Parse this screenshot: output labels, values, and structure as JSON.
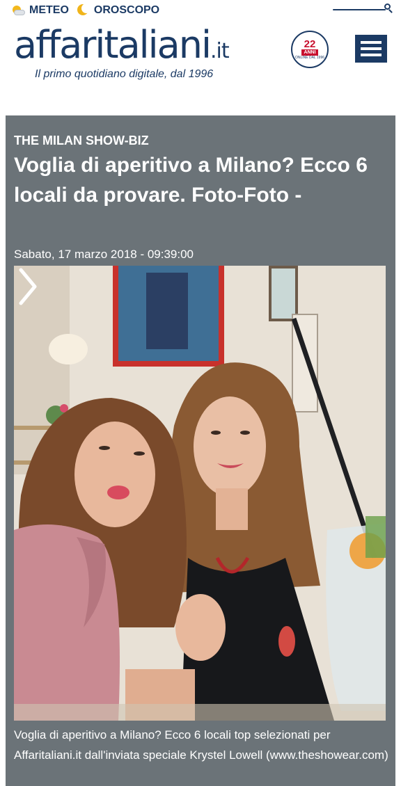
{
  "topbar": {
    "meteo_label": "METEO",
    "oroscopo_label": "OROSCOPO"
  },
  "logo": {
    "name": "affaritaliani",
    "tld": ".it",
    "tagline": "Il primo quotidiano digitale, dal 1996"
  },
  "badge": {
    "number": "22",
    "label": "ANNI",
    "subtext": "ONLINE DAL 1996"
  },
  "article": {
    "section": "THE MILAN SHOW-BIZ",
    "headline": "Voglia di aperitivo a Milano? Ecco 6 locali da provare. Foto-Foto -",
    "date": "Sabato, 17 marzo 2018 - 09:39:00",
    "caption": "Voglia di aperitivo a Milano? Ecco 6 locali top selezionati per Affaritaliani.it dall'inviata speciale Krystel Lowell (www.theshowear.com)"
  },
  "icons": {
    "weather": "sun-cloud-icon",
    "horoscope": "moon-icon",
    "search": "search-icon",
    "menu": "hamburger-menu-icon",
    "next": "chevron-right-icon"
  },
  "colors": {
    "brand": "#1b3a64",
    "card_bg": "#6b7378",
    "badge_red": "#c8102e"
  }
}
